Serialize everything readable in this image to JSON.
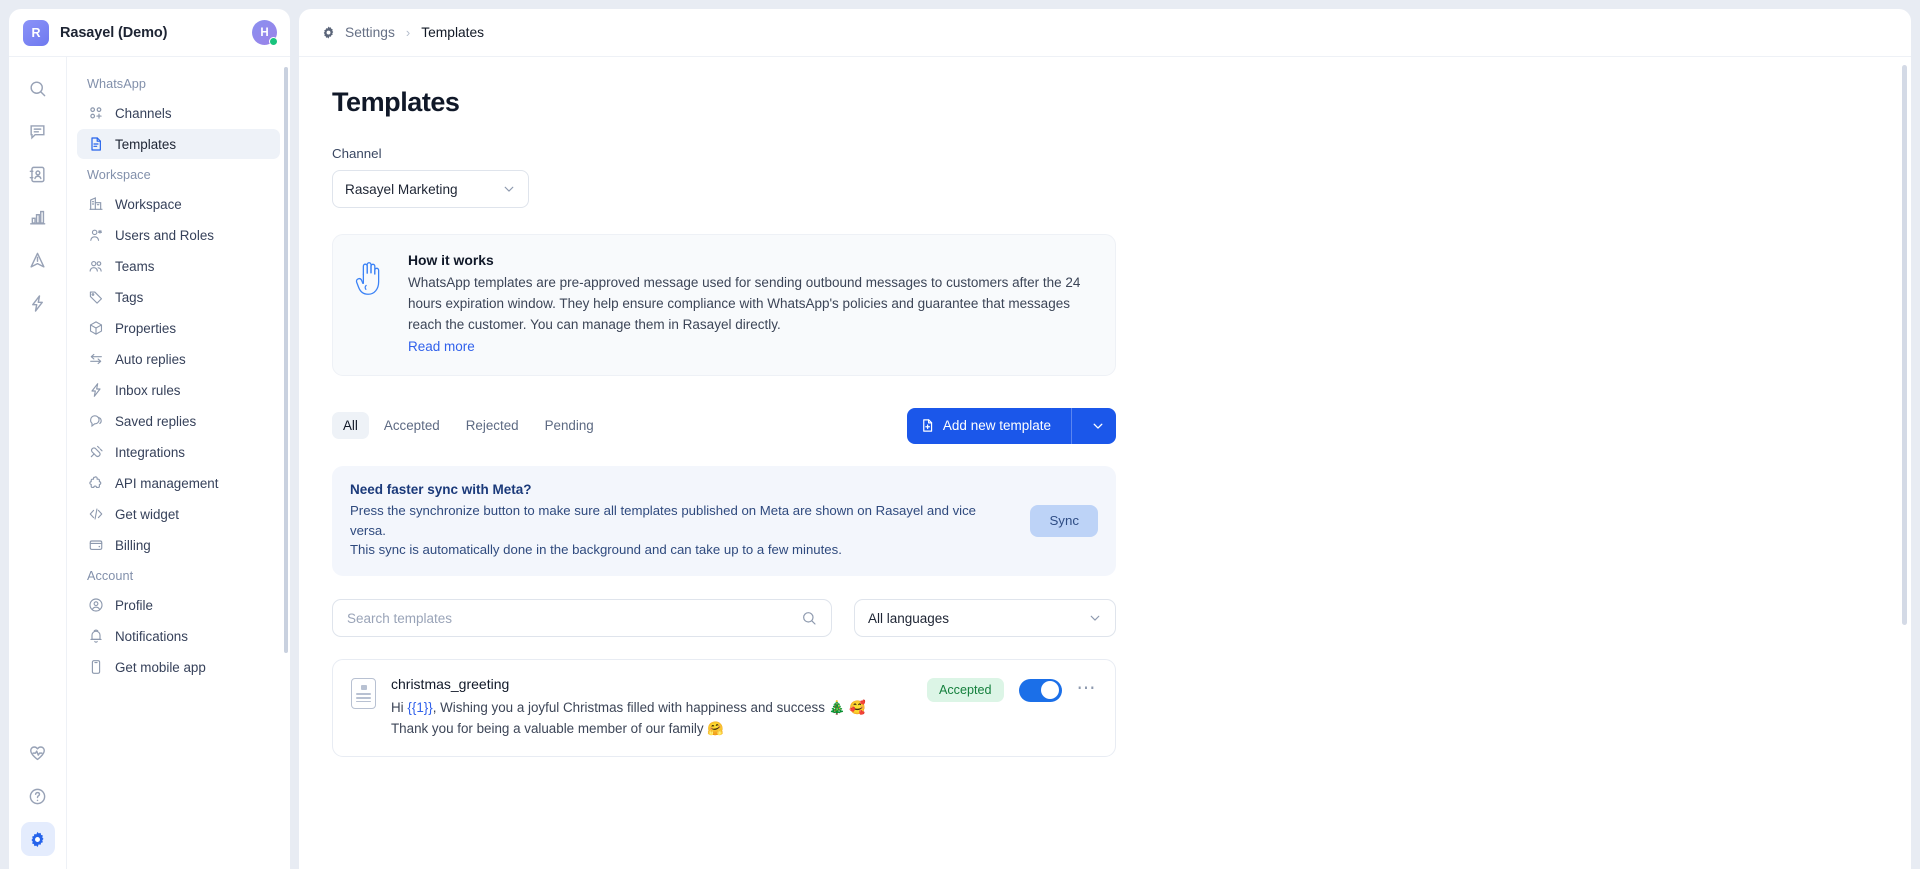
{
  "workspace": {
    "logo_letter": "R",
    "name": "Rasayel (Demo)",
    "avatar_letter": "H"
  },
  "rail": {
    "items": [
      {
        "name": "search-icon",
        "label": "Search"
      },
      {
        "name": "conversations-icon",
        "label": "Conversations"
      },
      {
        "name": "contacts-icon",
        "label": "Contacts"
      },
      {
        "name": "reports-icon",
        "label": "Reports"
      },
      {
        "name": "broadcasts-icon",
        "label": "Broadcasts"
      },
      {
        "name": "automations-icon",
        "label": "Automations"
      }
    ],
    "bottom": [
      {
        "name": "health-icon",
        "label": "Status"
      },
      {
        "name": "help-icon",
        "label": "Help"
      },
      {
        "name": "settings-icon",
        "label": "Settings",
        "active": true
      }
    ]
  },
  "sidebar": {
    "groups": [
      {
        "label": "WhatsApp",
        "items": [
          {
            "label": "Channels",
            "icon": "channels-icon",
            "active": false
          },
          {
            "label": "Templates",
            "icon": "templates-icon",
            "active": true
          }
        ]
      },
      {
        "label": "Workspace",
        "items": [
          {
            "label": "Workspace",
            "icon": "building-icon",
            "active": false
          },
          {
            "label": "Users and Roles",
            "icon": "user-settings-icon",
            "active": false
          },
          {
            "label": "Teams",
            "icon": "users-icon",
            "active": false
          },
          {
            "label": "Tags",
            "icon": "tag-icon",
            "active": false
          },
          {
            "label": "Properties",
            "icon": "cube-icon",
            "active": false
          },
          {
            "label": "Auto replies",
            "icon": "exchange-icon",
            "active": false
          },
          {
            "label": "Inbox rules",
            "icon": "bolt-icon",
            "active": false
          },
          {
            "label": "Saved replies",
            "icon": "chat-icon",
            "active": false
          },
          {
            "label": "Integrations",
            "icon": "plug-icon",
            "active": false
          },
          {
            "label": "API management",
            "icon": "puzzle-icon",
            "active": false
          },
          {
            "label": "Get widget",
            "icon": "code-icon",
            "active": false
          },
          {
            "label": "Billing",
            "icon": "wallet-icon",
            "active": false
          }
        ]
      },
      {
        "label": "Account",
        "items": [
          {
            "label": "Profile",
            "icon": "user-circle-icon",
            "active": false
          },
          {
            "label": "Notifications",
            "icon": "bell-icon",
            "active": false
          },
          {
            "label": "Get mobile app",
            "icon": "mobile-icon",
            "active": false
          }
        ]
      }
    ]
  },
  "breadcrumb": {
    "gear_icon": "gear-icon",
    "parent": "Settings",
    "separator": "›",
    "current": "Templates"
  },
  "page": {
    "title": "Templates",
    "channel_label": "Channel",
    "channel_value": "Rasayel Marketing"
  },
  "how_it_works": {
    "icon": "waving-hand-icon",
    "title": "How it works",
    "body": "WhatsApp templates are pre-approved message used for sending outbound messages to customers after the 24 hours expiration window. They help ensure compliance with WhatsApp's policies and guarantee that messages reach the customer. You can manage them in Rasayel directly.",
    "link": "Read more"
  },
  "tabs": [
    {
      "label": "All",
      "active": true
    },
    {
      "label": "Accepted",
      "active": false
    },
    {
      "label": "Rejected",
      "active": false
    },
    {
      "label": "Pending",
      "active": false
    }
  ],
  "add_button": {
    "label": "Add new template",
    "icon": "document-plus-icon",
    "chevron": "chevron-down-icon",
    "color": "#1b57ea"
  },
  "sync_banner": {
    "title": "Need faster sync with Meta?",
    "line1": "Press the synchronize button to make sure all templates published on Meta are shown on Rasayel and vice versa.",
    "line2": "This sync is automatically done in the background and can take up to a few minutes.",
    "button_label": "Sync"
  },
  "filters": {
    "search_placeholder": "Search templates",
    "search_value": "",
    "search_icon": "search-icon",
    "language_value": "All languages"
  },
  "templates": [
    {
      "name": "christmas_greeting",
      "body_prefix": "Hi ",
      "body_variable": "{{1}}",
      "body_suffix": ", Wishing you a joyful Christmas filled with happiness and success 🎄 🥰",
      "body_line2": "Thank you for being a valuable member of our family 🤗",
      "status": "Accepted",
      "status_color": "#15803d",
      "enabled": true,
      "menu_icon": "more-horizontal-icon"
    }
  ]
}
